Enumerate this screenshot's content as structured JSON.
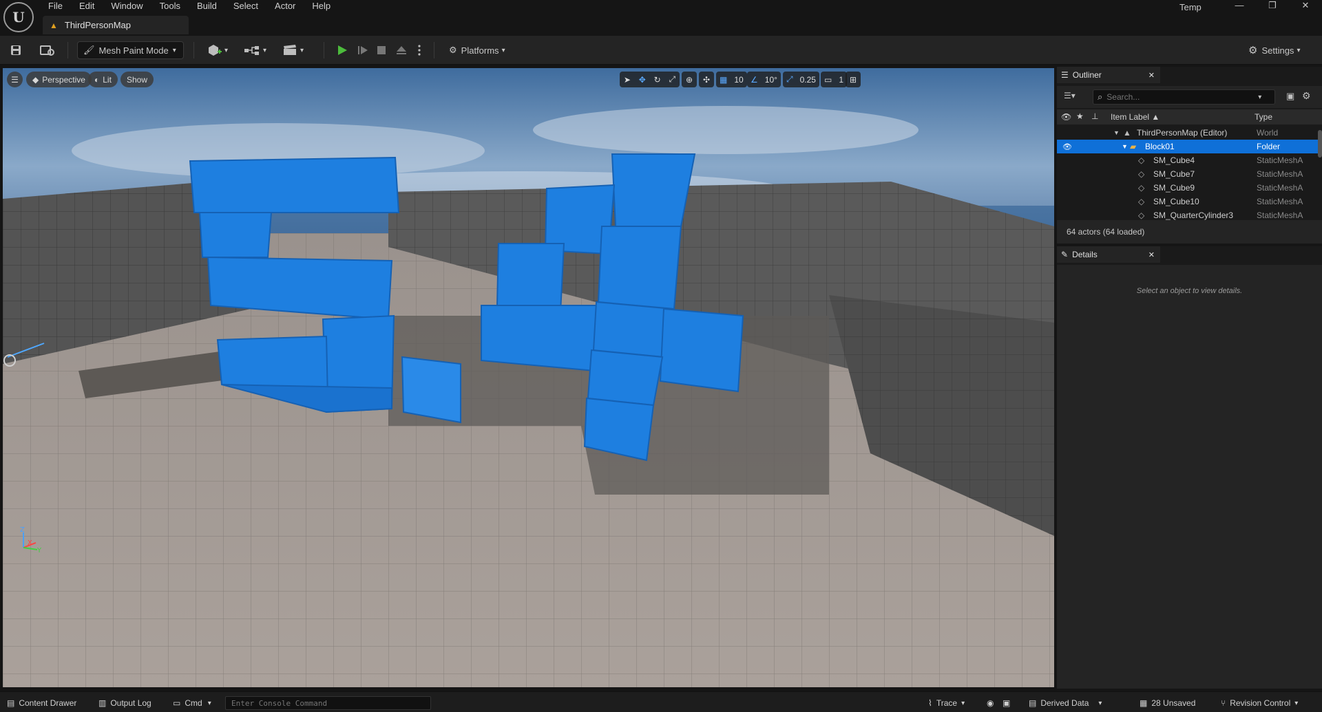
{
  "app": {
    "logo_text": "U",
    "menu": [
      "File",
      "Edit",
      "Window",
      "Tools",
      "Build",
      "Select",
      "Actor",
      "Help"
    ],
    "document_tab": "ThirdPersonMap",
    "project_name": "Temp"
  },
  "toolbar": {
    "mode_label": "Mesh Paint Mode",
    "platforms_label": "Platforms",
    "settings_label": "Settings"
  },
  "viewport": {
    "perspective_label": "Perspective",
    "lit_label": "Lit",
    "show_label": "Show",
    "grid_snap_value": "10",
    "rotation_snap_value": "10°",
    "scale_snap_value": "0.25",
    "camera_speed_value": "1",
    "axis_labels": {
      "z": "Z",
      "x": "X",
      "y": "Y"
    }
  },
  "outliner": {
    "tab_label": "Outliner",
    "search_placeholder": "Search...",
    "col_label": "Item Label ▲",
    "col_type": "Type",
    "rows": [
      {
        "label": "ThirdPersonMap (Editor)",
        "type": "World"
      },
      {
        "label": "Block01",
        "type": "Folder"
      },
      {
        "label": "SM_Cube4",
        "type": "StaticMeshA"
      },
      {
        "label": "SM_Cube7",
        "type": "StaticMeshA"
      },
      {
        "label": "SM_Cube9",
        "type": "StaticMeshA"
      },
      {
        "label": "SM_Cube10",
        "type": "StaticMeshA"
      },
      {
        "label": "SM_QuarterCylinder3",
        "type": "StaticMeshA"
      }
    ],
    "footer": "64 actors (64 loaded)"
  },
  "details": {
    "tab_label": "Details",
    "empty_message": "Select an object to view details."
  },
  "statusbar": {
    "content_drawer": "Content Drawer",
    "output_log": "Output Log",
    "cmd": "Cmd",
    "console_placeholder": "Enter Console Command",
    "trace": "Trace",
    "derived_data": "Derived Data",
    "unsaved": "28 Unsaved",
    "revision_control": "Revision Control"
  },
  "colors": {
    "selection_blue": "#0f70d8",
    "cube_blue": "#1e7fe0",
    "play_green": "#4cbc3c"
  }
}
